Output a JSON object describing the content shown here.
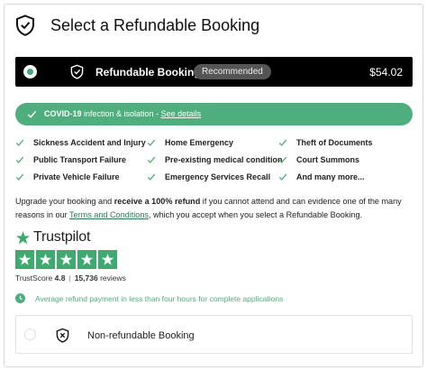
{
  "header": {
    "title": "Select a Refundable Booking"
  },
  "refundable": {
    "title": "Refundable Booking",
    "badge": "Recommended",
    "price": "$54.02"
  },
  "covid": {
    "bold": "COVID-19",
    "text": " infection & isolation - ",
    "link": "See details"
  },
  "features": [
    "Sickness Accident and Injury",
    "Home Emergency",
    "Theft of Documents",
    "Public Transport Failure",
    "Pre-existing medical condition",
    "Court Summons",
    "Private Vehicle Failure",
    "Emergency Services Recall",
    "And many more..."
  ],
  "description": {
    "part1": "Upgrade your booking and ",
    "bold": "receive a 100% refund",
    "part2": " if you cannot attend and can evidence one of the many reasons in our ",
    "link": "Terms and Conditions",
    "part3": ", which you accept when you select a Refundable Booking."
  },
  "trustpilot": {
    "name": "Trustpilot",
    "score_label": "TrustScore",
    "score": "4.8",
    "reviews_count": "15,736",
    "reviews_label": "reviews",
    "rating": 5
  },
  "avg_refund": "Average refund payment in less than four hours for complete applications",
  "non_refundable": {
    "title": "Non-refundable Booking"
  },
  "colors": {
    "accent_green": "#4fae7d",
    "trustpilot_green": "#3faa70",
    "bar_black": "#000000"
  }
}
